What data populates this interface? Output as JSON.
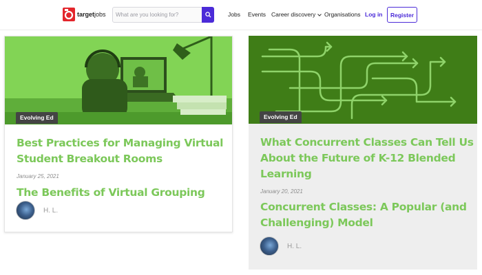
{
  "header": {
    "logo": {
      "name_bold": "target",
      "name_light": "jobs"
    },
    "search": {
      "placeholder": "What are you looking for?"
    },
    "nav": {
      "jobs": "Jobs",
      "events": "Events",
      "career": "Career discovery",
      "orgs": "Organisations",
      "login": "Log in",
      "register": "Register"
    },
    "accent_color": "#4b2bd8"
  },
  "cards": [
    {
      "tag": "Evolving Ed",
      "title_line1": "Best Practices for Managing Virtual",
      "title_line2": "Student Breakout Rooms",
      "date": "January 25, 2021",
      "subtitle_line1": "The Benefits of Virtual Grouping",
      "author": "H. L."
    },
    {
      "tag": "Evolving Ed",
      "title_line1": "What Concurrent Classes Can Tell Us",
      "title_line2": "About the Future of K-12 Blended",
      "title_line3": "Learning",
      "date": "January 20, 2021",
      "subtitle_line1": "Concurrent Classes: A Popular (and",
      "subtitle_line2": "Challenging) Model",
      "author": "H. L."
    }
  ],
  "colors": {
    "title_green": "#7cc85a",
    "card1_image_green": "#7ccf4f",
    "card2_image_green": "#3f7d17"
  }
}
